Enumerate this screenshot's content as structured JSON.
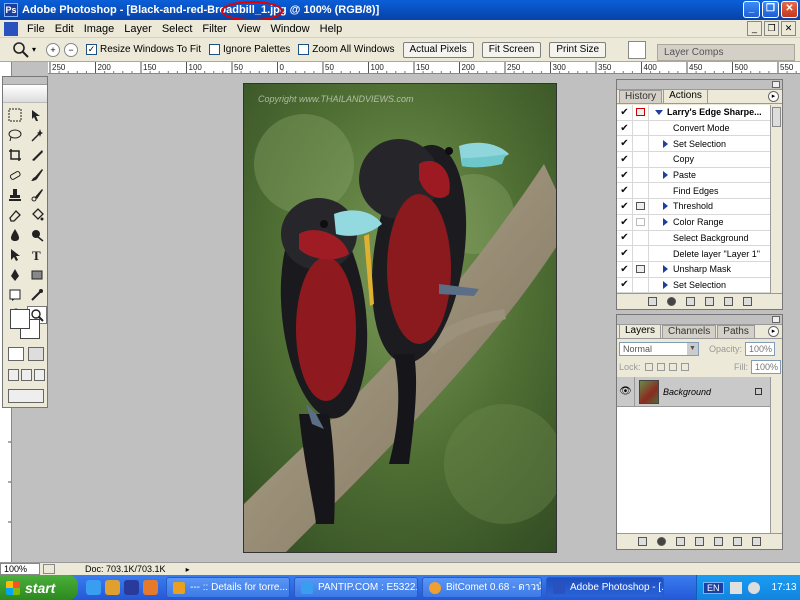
{
  "window": {
    "title": "Adobe Photoshop - [Black-and-red-Broadbill_1.jpg @ 100% (RGB/8)]",
    "app_icon": "photoshop-icon"
  },
  "menu": [
    "File",
    "Edit",
    "Image",
    "Layer",
    "Select",
    "Filter",
    "View",
    "Window",
    "Help"
  ],
  "options": {
    "resize_windows": "Resize Windows To Fit",
    "ignore_palettes": "Ignore Palettes",
    "zoom_all_windows": "Zoom All Windows",
    "actual_pixels": "Actual Pixels",
    "fit_screen": "Fit Screen",
    "print_size": "Print Size",
    "layer_comps": "Layer Comps"
  },
  "ruler_h": [
    "250",
    "200",
    "150",
    "100",
    "50",
    "0",
    "50",
    "100",
    "150",
    "200",
    "250",
    "300",
    "350",
    "400",
    "450",
    "500",
    "550"
  ],
  "image": {
    "watermark": "Copyright www.THAILANDVIEWS.com"
  },
  "history_panel": {
    "tabs": [
      "History",
      "Actions"
    ],
    "actions": [
      {
        "label": "Larry's Edge Sharpe...",
        "head": true,
        "dialog": "red"
      },
      {
        "label": "Convert Mode",
        "expand": false
      },
      {
        "label": "Set Selection",
        "expand": true
      },
      {
        "label": "Copy",
        "expand": false
      },
      {
        "label": "Paste",
        "expand": true
      },
      {
        "label": "Find Edges",
        "expand": false
      },
      {
        "label": "Threshold",
        "expand": true,
        "dialog": "gray"
      },
      {
        "label": "Color Range",
        "expand": true,
        "dialog": "empty"
      },
      {
        "label": "Select Background",
        "expand": false
      },
      {
        "label": "Delete layer \"Layer 1\"",
        "expand": false
      },
      {
        "label": "Unsharp Mask",
        "expand": true,
        "dialog": "gray"
      },
      {
        "label": "Set Selection",
        "expand": true
      }
    ]
  },
  "layers_panel": {
    "tabs": [
      "Layers",
      "Channels",
      "Paths"
    ],
    "blend_mode": "Normal",
    "opacity_label": "Opacity:",
    "opacity": "100%",
    "lock_label": "Lock:",
    "fill_label": "Fill:",
    "fill": "100%",
    "layers": [
      {
        "name": "Background"
      }
    ]
  },
  "status": {
    "zoom": "100%",
    "doc": "Doc: 703.1K/703.1K"
  },
  "taskbar": {
    "start": "start",
    "tasks": [
      {
        "label": "--- :: Details for torre...",
        "active": false
      },
      {
        "label": "PANTIP.COM : E5322...",
        "active": false
      },
      {
        "label": "BitComet 0.68 - ดาวน์...",
        "active": false
      },
      {
        "label": "Adobe Photoshop - [...",
        "active": true
      }
    ],
    "lang": "EN",
    "clock": "17:13"
  }
}
